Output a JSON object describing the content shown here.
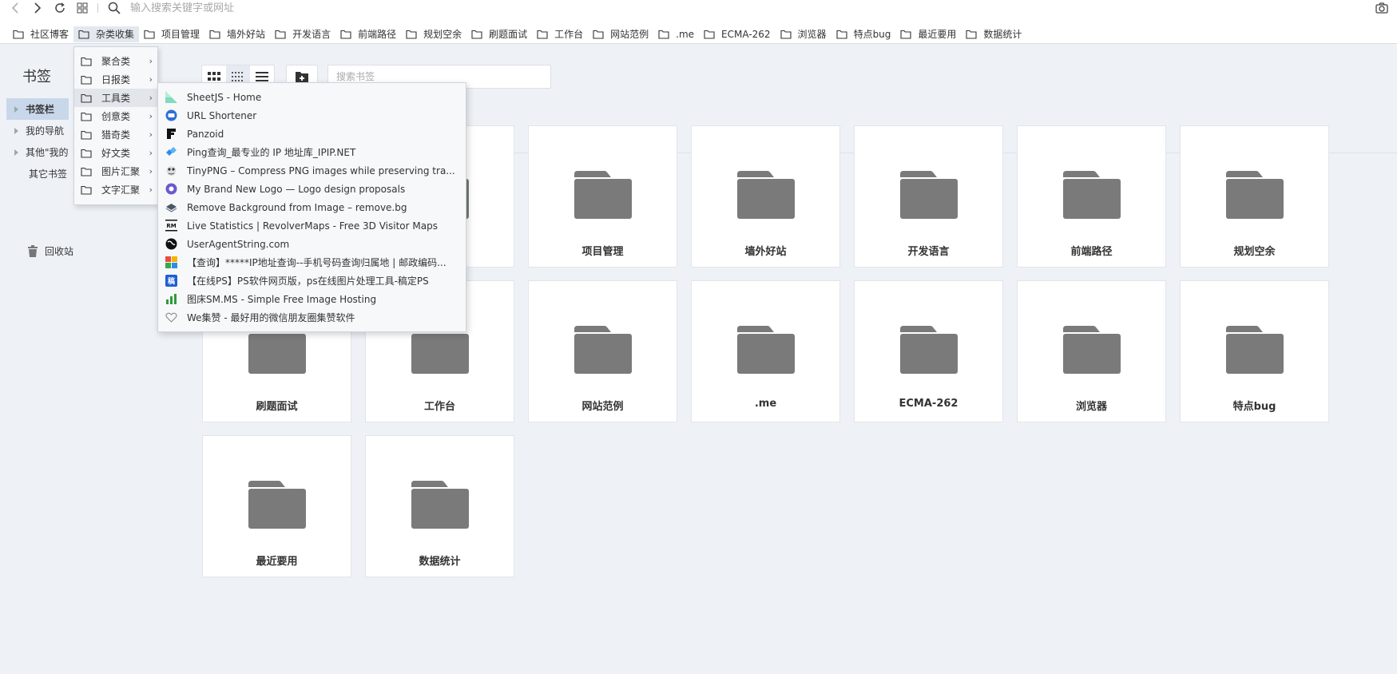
{
  "nav": {
    "address_placeholder": "输入搜索关键字或网址"
  },
  "bookmarks_bar": [
    {
      "label": "社区博客",
      "active": false
    },
    {
      "label": "杂类收集",
      "active": true
    },
    {
      "label": "项目管理",
      "active": false
    },
    {
      "label": "墙外好站",
      "active": false
    },
    {
      "label": "开发语言",
      "active": false
    },
    {
      "label": "前端路径",
      "active": false
    },
    {
      "label": "规划空余",
      "active": false
    },
    {
      "label": "刷题面试",
      "active": false
    },
    {
      "label": "工作台",
      "active": false
    },
    {
      "label": "网站范例",
      "active": false
    },
    {
      "label": ".me",
      "active": false
    },
    {
      "label": "ECMA-262",
      "active": false
    },
    {
      "label": "浏览器",
      "active": false
    },
    {
      "label": "特点bug",
      "active": false
    },
    {
      "label": "最近要用",
      "active": false
    },
    {
      "label": "数据统计",
      "active": false
    }
  ],
  "sidebar": {
    "title": "书签",
    "items": [
      {
        "label": "书签栏",
        "expandable": true,
        "selected": true
      },
      {
        "label": "我的导航",
        "expandable": true,
        "selected": false
      },
      {
        "label": "其他\"我的",
        "expandable": true,
        "selected": false
      },
      {
        "label": "其它书签",
        "expandable": false,
        "selected": false
      }
    ],
    "trash_label": "回收站"
  },
  "toolbar": {
    "search_placeholder": "搜索书签"
  },
  "grid": {
    "row1": [
      "",
      "",
      "项目管理",
      "墙外好站",
      "开发语言",
      "前端路径",
      "规划空余"
    ],
    "row2": [
      "刷题面试",
      "工作台",
      "网站范例",
      ".me",
      "ECMA-262",
      "浏览器",
      "特点bug"
    ],
    "row3": [
      "最近要用",
      "数据统计"
    ]
  },
  "submenu": {
    "items": [
      {
        "label": "聚合类"
      },
      {
        "label": "日报类"
      },
      {
        "label": "工具类",
        "highlighted": true
      },
      {
        "label": "创意类"
      },
      {
        "label": "猎奇类"
      },
      {
        "label": "好文类"
      },
      {
        "label": "图片汇聚"
      },
      {
        "label": "文字汇聚"
      }
    ]
  },
  "tools_menu": {
    "items": [
      {
        "label": "SheetJS - Home",
        "icon": "sheetjs-icon",
        "color": "#7fdcbc"
      },
      {
        "label": "URL Shortener",
        "icon": "url-shortener-icon",
        "color": "#2f6fd3"
      },
      {
        "label": "Panzoid",
        "icon": "panzoid-icon",
        "color": "#111111"
      },
      {
        "label": "Ping查询_最专业的 IP 地址库_IPIP.NET",
        "icon": "ipip-icon",
        "color": "#2b8fe8"
      },
      {
        "label": "TinyPNG – Compress PNG images while preserving tra...",
        "icon": "tinypng-icon",
        "color": "#333333"
      },
      {
        "label": "My Brand New Logo — Logo design proposals",
        "icon": "brandlogo-icon",
        "color": "#6a5acd"
      },
      {
        "label": "Remove Background from Image – remove.bg",
        "icon": "removebg-icon",
        "color": "#4a5568"
      },
      {
        "label": "Live Statistics | RevolverMaps - Free 3D Visitor Maps",
        "icon": "revolvermaps-icon",
        "color": "#111111"
      },
      {
        "label": "UserAgentString.com",
        "icon": "globe-icon",
        "color": "#111111"
      },
      {
        "label": "【查询】*****IP地址查询--手机号码查询归属地 | 邮政编码...",
        "icon": "ip138-icon",
        "color": "#3aa845"
      },
      {
        "label": "【在线PS】PS软件网页版，ps在线图片处理工具-稿定PS",
        "icon": "gaoding-icon",
        "color": "#1f5fd6"
      },
      {
        "label": "图床SM.MS - Simple Free Image Hosting",
        "icon": "smms-icon",
        "color": "#2e9b3c"
      },
      {
        "label": "We集赞 - 最好用的微信朋友圈集赞软件",
        "icon": "heart-icon",
        "color": "#888888"
      }
    ]
  }
}
